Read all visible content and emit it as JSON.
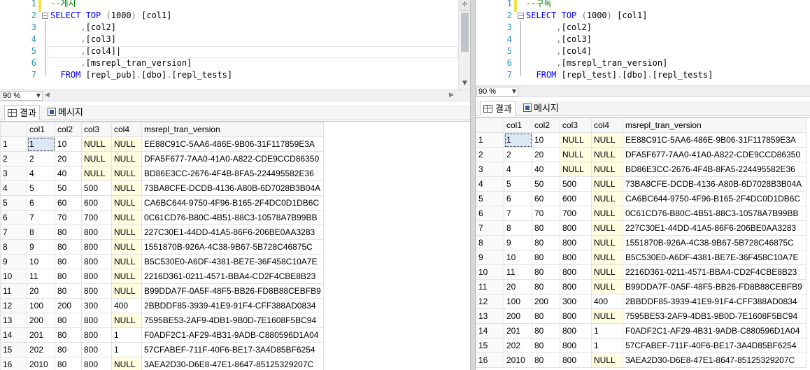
{
  "zoom": "90 %",
  "tabs": {
    "results": "결과",
    "messages": "메시지"
  },
  "columns": [
    "col1",
    "col2",
    "col3",
    "col4",
    "msrepl_tran_version"
  ],
  "left": {
    "code": [
      {
        "n": "1",
        "parts": [
          {
            "c": "cm",
            "t": "--게시"
          }
        ]
      },
      {
        "n": "2",
        "parts": [
          {
            "c": "kw",
            "t": "SELECT"
          },
          {
            "c": "tx",
            "t": " "
          },
          {
            "c": "kw",
            "t": "TOP"
          },
          {
            "c": "tx",
            "t": " "
          },
          {
            "c": "gr",
            "t": "("
          },
          {
            "c": "tx",
            "t": "1000"
          },
          {
            "c": "gr",
            "t": ")"
          },
          {
            "c": "tx",
            "t": " [col1]"
          }
        ]
      },
      {
        "n": "3",
        "parts": [
          {
            "c": "tx",
            "t": "      "
          },
          {
            "c": "gr",
            "t": ","
          },
          {
            "c": "tx",
            "t": "[col2]"
          }
        ]
      },
      {
        "n": "4",
        "parts": [
          {
            "c": "tx",
            "t": "      "
          },
          {
            "c": "gr",
            "t": ","
          },
          {
            "c": "tx",
            "t": "[col3]"
          }
        ]
      },
      {
        "n": "5",
        "parts": [
          {
            "c": "tx",
            "t": "      "
          },
          {
            "c": "gr",
            "t": ","
          },
          {
            "c": "tx",
            "t": "[col4]|"
          }
        ]
      },
      {
        "n": "6",
        "parts": [
          {
            "c": "tx",
            "t": "      "
          },
          {
            "c": "gr",
            "t": ","
          },
          {
            "c": "tx",
            "t": "[msrepl_tran_version]"
          }
        ]
      },
      {
        "n": "7",
        "parts": [
          {
            "c": "tx",
            "t": "  "
          },
          {
            "c": "kw",
            "t": "FROM"
          },
          {
            "c": "tx",
            "t": " [repl_pub]"
          },
          {
            "c": "gr",
            "t": "."
          },
          {
            "c": "tx",
            "t": "[dbo]"
          },
          {
            "c": "gr",
            "t": "."
          },
          {
            "c": "tx",
            "t": "[repl_tests]"
          }
        ]
      }
    ]
  },
  "right": {
    "code": [
      {
        "n": "1",
        "parts": [
          {
            "c": "cm",
            "t": "--구독"
          }
        ]
      },
      {
        "n": "2",
        "parts": [
          {
            "c": "kw",
            "t": "SELECT"
          },
          {
            "c": "tx",
            "t": " "
          },
          {
            "c": "kw",
            "t": "TOP"
          },
          {
            "c": "tx",
            "t": " "
          },
          {
            "c": "gr",
            "t": "("
          },
          {
            "c": "tx",
            "t": "1000"
          },
          {
            "c": "gr",
            "t": ")"
          },
          {
            "c": "tx",
            "t": " [col1]"
          }
        ]
      },
      {
        "n": "3",
        "parts": [
          {
            "c": "tx",
            "t": "      "
          },
          {
            "c": "gr",
            "t": ","
          },
          {
            "c": "tx",
            "t": "[col2]"
          }
        ]
      },
      {
        "n": "4",
        "parts": [
          {
            "c": "tx",
            "t": "      "
          },
          {
            "c": "gr",
            "t": ","
          },
          {
            "c": "tx",
            "t": "[col3]"
          }
        ]
      },
      {
        "n": "5",
        "parts": [
          {
            "c": "tx",
            "t": "      "
          },
          {
            "c": "gr",
            "t": ","
          },
          {
            "c": "tx",
            "t": "[col4]"
          }
        ]
      },
      {
        "n": "6",
        "parts": [
          {
            "c": "tx",
            "t": "      "
          },
          {
            "c": "gr",
            "t": ","
          },
          {
            "c": "tx",
            "t": "[msrepl_tran_version]"
          }
        ]
      },
      {
        "n": "7",
        "parts": [
          {
            "c": "tx",
            "t": "  "
          },
          {
            "c": "kw",
            "t": "FROM"
          },
          {
            "c": "tx",
            "t": " [repl_test]"
          },
          {
            "c": "gr",
            "t": "."
          },
          {
            "c": "tx",
            "t": "[dbo]"
          },
          {
            "c": "gr",
            "t": "."
          },
          {
            "c": "tx",
            "t": "[repl_tests]"
          }
        ]
      }
    ]
  },
  "rows": [
    [
      "1",
      "1",
      "10",
      "NULL",
      "NULL",
      "EE88C91C-5AA6-486E-9B06-31F117859E3A"
    ],
    [
      "2",
      "2",
      "20",
      "NULL",
      "NULL",
      "DFA5F677-7AA0-41A0-A822-CDE9CCD86350"
    ],
    [
      "3",
      "4",
      "40",
      "NULL",
      "NULL",
      "BD86E3CC-2676-4F4B-8FA5-224495582E36"
    ],
    [
      "4",
      "5",
      "50",
      "500",
      "NULL",
      "73BA8CFE-DCDB-4136-A80B-6D7028B3B04A"
    ],
    [
      "5",
      "6",
      "60",
      "600",
      "NULL",
      "CA6BC644-9750-4F96-B165-2F4DC0D1DB6C"
    ],
    [
      "6",
      "7",
      "70",
      "700",
      "NULL",
      "0C61CD76-B80C-4B51-88C3-10578A7B99BB"
    ],
    [
      "7",
      "8",
      "80",
      "800",
      "NULL",
      "227C30E1-44DD-41A5-86F6-206BE0AA3283"
    ],
    [
      "8",
      "9",
      "80",
      "800",
      "NULL",
      "1551870B-926A-4C38-9B67-5B728C46875C"
    ],
    [
      "9",
      "10",
      "80",
      "800",
      "NULL",
      "B5C530E0-A6DF-4381-BE7E-36F458C10A7E"
    ],
    [
      "10",
      "11",
      "80",
      "800",
      "NULL",
      "2216D361-0211-4571-BBA4-CD2F4CBE8B23"
    ],
    [
      "11",
      "20",
      "80",
      "800",
      "NULL",
      "B99DDA7F-0A5F-48F5-BB26-FD8B88CEBFB9"
    ],
    [
      "12",
      "100",
      "200",
      "300",
      "400",
      "2BBDDF85-3939-41E9-91F4-CFF388AD0834"
    ],
    [
      "13",
      "200",
      "80",
      "800",
      "NULL",
      "7595BE53-2AF9-4DB1-9B0D-7E1608F5BC94"
    ],
    [
      "14",
      "201",
      "80",
      "800",
      "1",
      "F0ADF2C1-AF29-4B31-9ADB-C880596D1A04"
    ],
    [
      "15",
      "202",
      "80",
      "800",
      "1",
      "57CFABEF-711F-40F6-BE17-3A4D85BF6254"
    ],
    [
      "16",
      "2010",
      "80",
      "800",
      "NULL",
      "3AEA2D30-D6E8-47E1-8647-85125329207C"
    ]
  ]
}
